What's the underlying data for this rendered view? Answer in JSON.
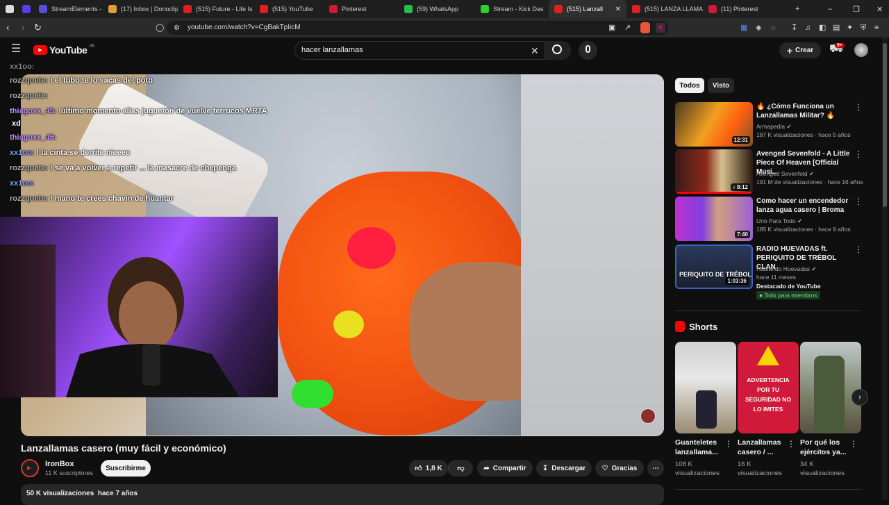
{
  "browser": {
    "tabs": [
      {
        "label": "",
        "color": "#dddddd"
      },
      {
        "label": "",
        "color": "#5a3cf0"
      },
      {
        "label": "StreamElements - My",
        "color": "#5b4ce0"
      },
      {
        "label": "(17) Inbox | Donoclip",
        "color": "#e0a030"
      },
      {
        "label": "(515) Future - Life Is G",
        "color": "#e02020"
      },
      {
        "label": "(515) YouTube",
        "color": "#e02020"
      },
      {
        "label": "Pinterest",
        "color": "#d01838"
      },
      {
        "label": "(59) WhatsApp",
        "color": "#25c04a"
      },
      {
        "label": "Stream - Kick Das",
        "color": "#30d030"
      },
      {
        "label": "(515) Lanzall",
        "color": "#e02020"
      },
      {
        "label": "(515) LANZA LLAMAS",
        "color": "#e02020"
      },
      {
        "label": "(11) Pinterest",
        "color": "#d01838"
      }
    ],
    "active_tab_close": "✕",
    "new_tab": "+",
    "url": "youtube.com/watch?v=CgBakTpIicM"
  },
  "yt": {
    "logo": "YouTube",
    "region": "PE",
    "search_value": "hacer lanzallamas",
    "create_label": "Crear",
    "notif_badge": "9+"
  },
  "chat": [
    {
      "user": "xx1oo:",
      "msg": "",
      "user_color": "#8a8a8a"
    },
    {
      "user": "rozzquete:",
      "msg": "! el tubo te lo sacas del poto",
      "user_color": "#b0b0b0"
    },
    {
      "user": "rozzquete:",
      "msg": "",
      "user_color": "#b0b0b0"
    },
    {
      "user": "thiagoxx_45:",
      "msg": "!último momento alias juguetón de vuelve terrucos MRTA",
      "user_color": "#c090ff"
    },
    {
      "user": "",
      "msg": "xd",
      "user_color": "#ffffff"
    },
    {
      "user": "thiagoxx_45:",
      "msg": "",
      "user_color": "#c090ff"
    },
    {
      "user": "xx1oo:",
      "msg": "! la cinta se derrite nieeee",
      "user_color": "#7fa0ff"
    },
    {
      "user": "rozzquete:",
      "msg": "! se va a volver a repetir ... la masacre de chepenga",
      "user_color": "#b0b0b0"
    },
    {
      "user": "xx1oo:",
      "msg": "",
      "user_color": "#7fa0ff"
    },
    {
      "user": "rozzquete:",
      "msg": "! mano te crees chavin de huantar",
      "user_color": "#b0b0b0"
    }
  ],
  "video": {
    "title": "Lanzallamas casero (muy fácil y económico)",
    "channel": "IronBox",
    "subscribers": "11 K suscriptores",
    "subscribe_label": "Suscribirme",
    "likes": "1,8 K",
    "share_label": "Compartir",
    "download_label": "Descargar",
    "thanks_label": "Gracias",
    "views": "50 K visualizaciones",
    "age": "hace 7 años"
  },
  "sidebar": {
    "chips": [
      "Todos",
      "Visto"
    ],
    "recs": [
      {
        "title": "🔥 ¿Cómo Funciona un Lanzallamas Militar? 🔥",
        "channel": "Armapedia",
        "meta": "187 K visualizaciones · hace 5 años",
        "duration": "12:31"
      },
      {
        "title": "Avenged Sevenfold - A Little Piece Of Heaven [Official Musi...",
        "channel": "Avenged Sevenfold",
        "meta": "191 M de visualizaciones · hace 16 años",
        "duration": "♪ 8:12"
      },
      {
        "title": "Como hacer un encendedor lanza agua casero | Broma",
        "channel": "Uno Para Todo",
        "meta": "185 K visualizaciones · hace 9 años",
        "duration": "7:40"
      },
      {
        "title": "RADIO HUEVADAS ft. PERIQUITO DE TRÉBOL CLAN",
        "channel": "Hablando Huevadas",
        "meta": "hace 11 meses",
        "duration": "1:03:36",
        "extra": "Destacado de YouTube",
        "badge": "Solo para miembros",
        "thumb_text": "PERIQUITO DE TRÉBOL CL"
      }
    ],
    "shorts_title": "Shorts",
    "shorts": [
      {
        "title": "Guanteletes lanzallama...",
        "views": "108 K visualizaciones",
        "thumb_text": ""
      },
      {
        "title": "Lanzallamas casero / ...",
        "views": "16 K visualizaciones",
        "thumb_text": "ADVERTENCIA\nPOR TU SEGURIDAD NO LO IMITES"
      },
      {
        "title": "Por qué los ejércitos ya...",
        "views": "34 K visualizaciones",
        "thumb_text": ""
      }
    ]
  }
}
